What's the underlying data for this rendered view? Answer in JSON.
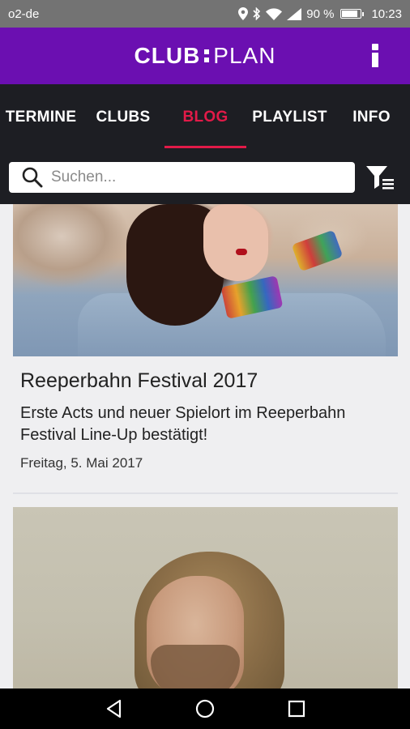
{
  "status_bar": {
    "carrier": "o2-de",
    "battery": "90 %",
    "battery_level": 0.9,
    "time": "10:23"
  },
  "app_bar": {
    "logo_left": "CLUB",
    "logo_right": "PLAN"
  },
  "tabs": [
    {
      "label": "TERMINE",
      "active": false
    },
    {
      "label": "CLUBS",
      "active": false
    },
    {
      "label": "BLOG",
      "active": true
    },
    {
      "label": "PLAYLIST",
      "active": false
    },
    {
      "label": "INFO",
      "active": false
    }
  ],
  "search": {
    "placeholder": "Suchen...",
    "value": ""
  },
  "posts": [
    {
      "title": "Reeperbahn Festival 2017",
      "description": "Erste Acts und neuer Spielort im Reeperbahn Festival Line-Up bestätigt!",
      "date": "Freitag, 5. Mai 2017"
    }
  ],
  "colors": {
    "brand_purple": "#6b0fb1",
    "accent_red": "#e21a48",
    "tab_bar": "#1d1e23"
  },
  "icons": {
    "search": "search-icon",
    "filter": "filter-list-icon",
    "info": "info-icon",
    "back": "back-triangle-icon",
    "home": "home-circle-icon",
    "recents": "recents-square-icon"
  }
}
